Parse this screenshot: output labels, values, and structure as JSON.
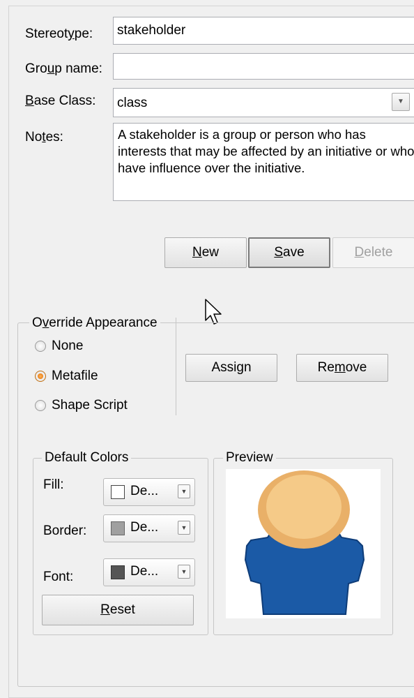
{
  "form": {
    "stereotype_label": "Stereotype:",
    "stereotype_value": "stakeholder",
    "group_name_label": "Group name:",
    "group_name_value": "",
    "base_class_label": "Base Class:",
    "base_class_value": "class",
    "notes_label": "Notes:",
    "notes_value": "A stakeholder is a group or person who has interests that may be affected by an initiative or who have influence over the initiative."
  },
  "buttons": {
    "new_label": "New",
    "save_label": "Save",
    "delete_label": "Delete",
    "assign_label": "Assign",
    "remove_label": "Remove",
    "reset_label": "Reset"
  },
  "override_appearance": {
    "title": "Override Appearance",
    "options": [
      "None",
      "Metafile",
      "Shape Script"
    ],
    "selected": "Metafile"
  },
  "default_colors": {
    "title": "Default Colors",
    "fill_label": "Fill:",
    "fill_value": "De...",
    "fill_color": "#ffffff",
    "border_label": "Border:",
    "border_value": "De...",
    "border_color": "#a0a0a0",
    "font_label": "Font:",
    "font_value": "De...",
    "font_color": "#555555"
  },
  "preview": {
    "title": "Preview",
    "icon": "stakeholder-person-icon",
    "head_color": "#f2c47c",
    "body_color": "#1b5aa6"
  }
}
